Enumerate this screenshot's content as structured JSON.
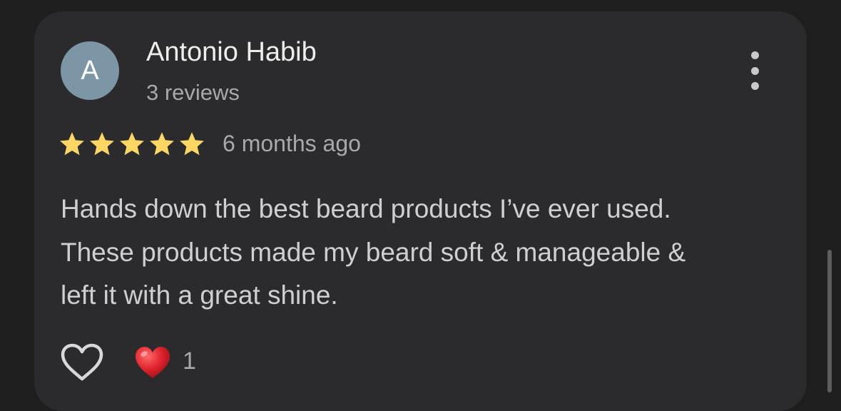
{
  "review": {
    "avatar_letter": "A",
    "author": "Antonio Habib",
    "review_count": "3 reviews",
    "rating": 5,
    "max_rating": 5,
    "time_ago": "6 months ago",
    "text_lines": [
      "Hands down the best beard products I’ve ever used.",
      "These products made my beard soft & manageable &",
      "left it with a great shine."
    ],
    "reaction_count": "1"
  },
  "icons": {
    "more": "more-vertical-icon",
    "star": "star-icon",
    "like": "heart-outline-icon",
    "reaction": "red-heart-icon"
  },
  "colors": {
    "background": "#1e1e1f",
    "card": "#2b2b2d",
    "avatar": "#7c96a6",
    "star": "#fdd663",
    "heart_red": "#e0242e"
  }
}
